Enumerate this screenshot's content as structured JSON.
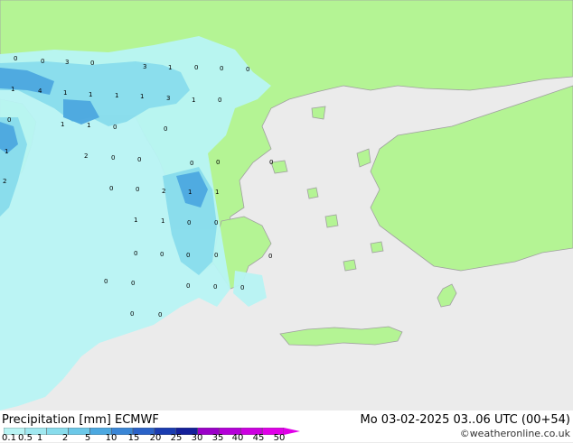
{
  "footer": {
    "title": "Precipitation [mm]  ECMWF",
    "run": "Mo 03-02-2025 03..06 UTC (00+54)",
    "credit": "©weatheronline.co.uk"
  },
  "legend": {
    "ticks": [
      "0.1",
      "0.5",
      "1",
      "2",
      "5",
      "10",
      "15",
      "20",
      "25",
      "30",
      "35",
      "40",
      "45",
      "50"
    ],
    "colors": [
      "#b8f4f4",
      "#a0e8f0",
      "#88dcec",
      "#6cc8e8",
      "#4ca8e0",
      "#3a86d6",
      "#2a62c8",
      "#1a3cb0",
      "#14209a",
      "#9a00c8",
      "#b400d8",
      "#cc00e0",
      "#e000e8"
    ]
  },
  "map_colors": {
    "sea": "#ebebeb",
    "land": "#b4f494",
    "precip_light": "#b8f4f4",
    "precip_medium": "#88dcec",
    "precip_heavy": "#4ca8e0"
  },
  "labels": [
    "0",
    "0",
    "3",
    "0",
    "3",
    "1",
    "0",
    "0",
    "0",
    "1",
    "4",
    "1",
    "1",
    "1",
    "1",
    "0",
    "3",
    "1",
    "0",
    "1",
    "1",
    "0",
    "1",
    "2",
    "0",
    "0",
    "0",
    "0",
    "0",
    "0",
    "2",
    "2",
    "1",
    "0",
    "0",
    "1",
    "1",
    "0",
    "1",
    "0",
    "0",
    "0",
    "0",
    "0",
    "0",
    "0",
    "0",
    "0",
    "0",
    "0",
    "0",
    "0"
  ]
}
